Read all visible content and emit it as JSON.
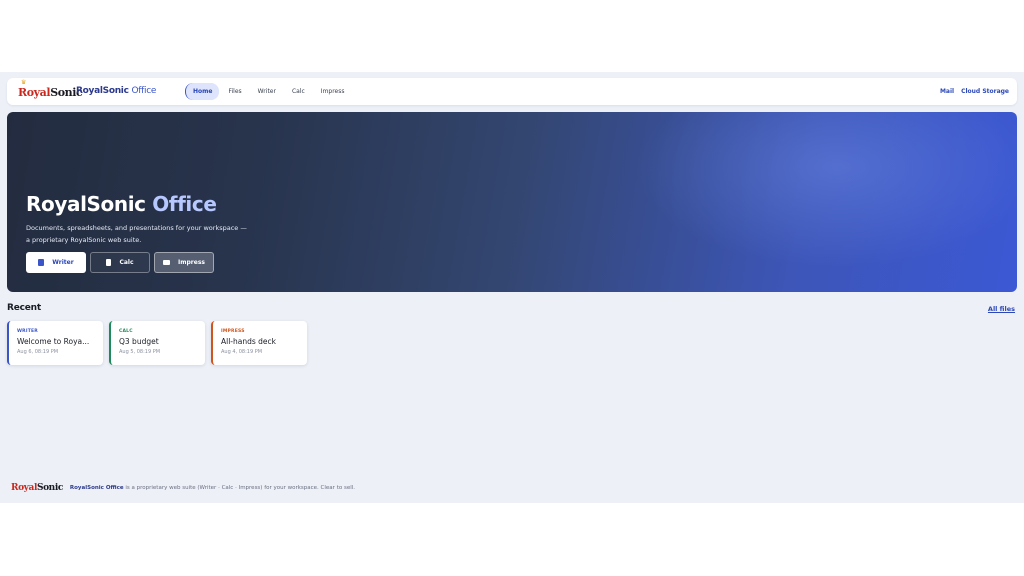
{
  "nav": {
    "logo_royal": "Royal",
    "logo_sonic": "Sonic",
    "brand_main": "RoyalSonic",
    "brand_sub": "Office",
    "tabs": [
      "Home",
      "Files",
      "Writer",
      "Calc",
      "Impress"
    ],
    "right_links": [
      "Mail",
      "Cloud Storage"
    ]
  },
  "hero": {
    "title_main": "RoyalSonic",
    "title_accent": "Office",
    "desc_line1": "Documents, spreadsheets, and presentations for your workspace —",
    "desc_line2": "a proprietary RoyalSonic web suite.",
    "buttons": [
      "Writer",
      "Calc",
      "Impress"
    ]
  },
  "recent": {
    "title": "Recent",
    "all_files": "All files",
    "cards": [
      {
        "kind": "WRITER",
        "name": "Welcome to Roya...",
        "date": "Aug 6, 08:19 PM",
        "color": "#3a55c8"
      },
      {
        "kind": "CALC",
        "name": "Q3 budget",
        "date": "Aug 5, 08:19 PM",
        "color": "#1c8a5a"
      },
      {
        "kind": "IMPRESS",
        "name": "All-hands deck",
        "date": "Aug 4, 08:19 PM",
        "color": "#d2541a"
      }
    ]
  },
  "footer": {
    "brand": "RoyalSonic Office",
    "text": " is a proprietary web suite (Writer · Calc · Impress) for your workspace. Clear to sell."
  }
}
